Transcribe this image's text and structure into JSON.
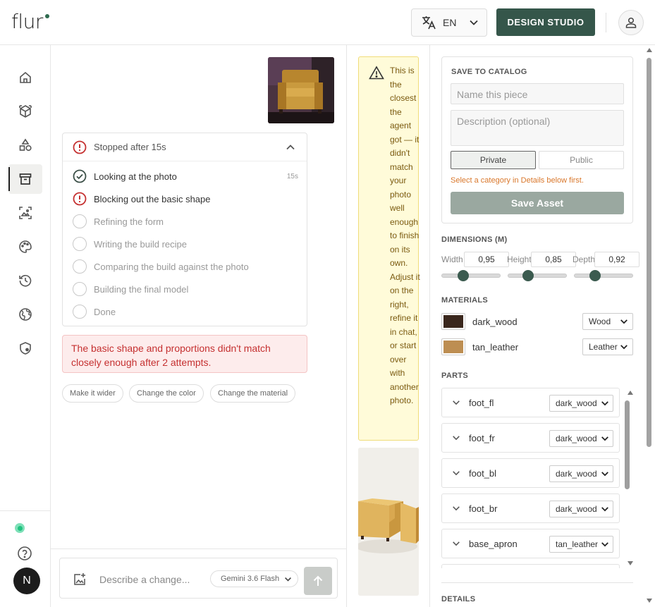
{
  "header": {
    "logo": "flur",
    "language": "EN",
    "design_studio_label": "DESIGN STUDIO"
  },
  "sidebar": {
    "items": [
      "home-icon",
      "cube-icon",
      "shapes-icon",
      "archive-icon",
      "image-frame-icon",
      "palette-icon",
      "history-icon",
      "globe-icon",
      "shield-user-icon"
    ],
    "active_item": "archive-icon",
    "avatar_initial": "N"
  },
  "progress": {
    "title": "Stopped after 15s",
    "steps": [
      {
        "label": "Looking at the photo",
        "status": "done",
        "duration": "15s"
      },
      {
        "label": "Blocking out the basic shape",
        "status": "error"
      },
      {
        "label": "Refining the form",
        "status": "pending"
      },
      {
        "label": "Writing the build recipe",
        "status": "pending"
      },
      {
        "label": "Comparing the build against the photo",
        "status": "pending"
      },
      {
        "label": "Building the final model",
        "status": "pending"
      },
      {
        "label": "Done",
        "status": "pending"
      }
    ]
  },
  "error_message": "The basic shape and proportions didn't match closely enough after 2 attempts.",
  "suggestions": [
    "Make it wider",
    "Change the color",
    "Change the material"
  ],
  "composer": {
    "placeholder": "Describe a change...",
    "model": "Gemini 3.6 Flash"
  },
  "warning": {
    "text": "This is the closest the agent got — it didn't match your photo well enough to finish on its own. Adjust it on the right, refine it in chat, or start over with another photo."
  },
  "save_catalog": {
    "title": "SAVE TO CATALOG",
    "name_placeholder": "Name this piece",
    "description_placeholder": "Description (optional)",
    "visibility_options": [
      "Private",
      "Public"
    ],
    "selected_visibility": "Private",
    "category_hint": "Select a category in Details below first.",
    "save_label": "Save Asset"
  },
  "dimensions": {
    "title": "DIMENSIONS (M)",
    "width_label": "Width",
    "width": "0,95",
    "height_label": "Height",
    "height": "0,85",
    "depth_label": "Depth",
    "depth": "0,92",
    "slider_fractions": {
      "width": 0.36,
      "height": 0.33,
      "depth": 0.34
    }
  },
  "materials": {
    "title": "MATERIALS",
    "items": [
      {
        "name": "dark_wood",
        "type": "Wood",
        "color": "#3a271d"
      },
      {
        "name": "tan_leather",
        "type": "Leather",
        "color": "#bd8e52"
      }
    ]
  },
  "parts": {
    "title": "PARTS",
    "items": [
      {
        "name": "foot_fl",
        "material": "dark_wood"
      },
      {
        "name": "foot_fr",
        "material": "dark_wood"
      },
      {
        "name": "foot_bl",
        "material": "dark_wood"
      },
      {
        "name": "foot_br",
        "material": "dark_wood"
      },
      {
        "name": "base_apron",
        "material": "tan_leather"
      }
    ]
  },
  "details": {
    "title": "DETAILS"
  },
  "colors": {
    "accent": "#35564a",
    "error": "#c53030",
    "warning_bg": "#fffbd9",
    "hint": "#d9772b"
  }
}
